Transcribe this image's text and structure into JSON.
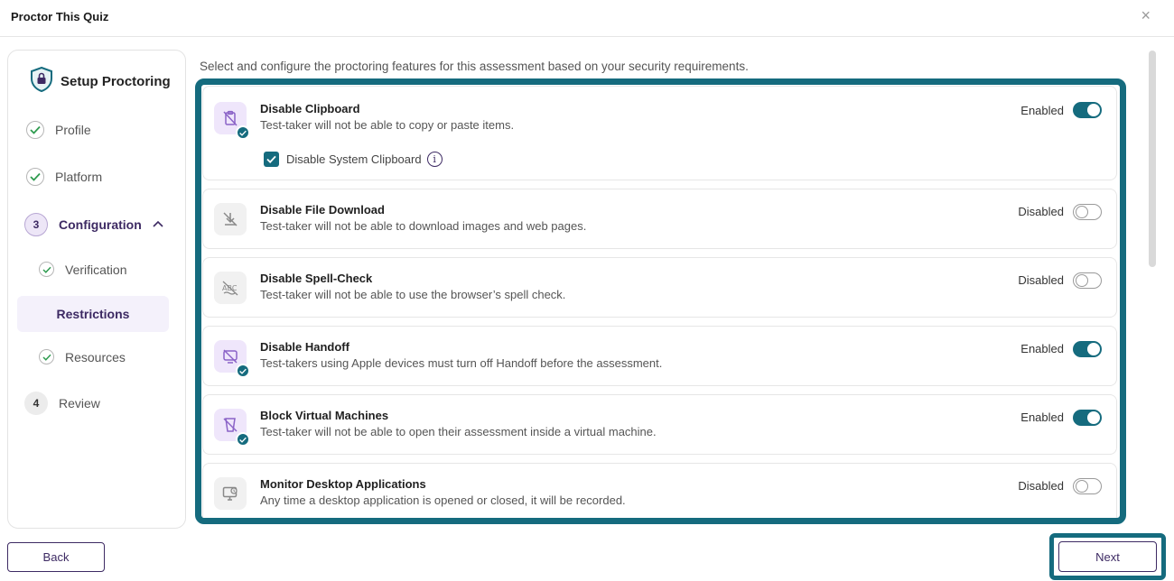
{
  "header": {
    "title": "Proctor This Quiz",
    "close_symbol": "×"
  },
  "sidebar": {
    "title": "Setup Proctoring",
    "steps": [
      {
        "label": "Profile",
        "state": "done"
      },
      {
        "label": "Platform",
        "state": "done"
      },
      {
        "label": "Configuration",
        "number": "3",
        "state": "active",
        "substeps": [
          {
            "label": "Verification",
            "state": "done"
          },
          {
            "label": "Restrictions",
            "state": "current"
          },
          {
            "label": "Resources",
            "state": "done"
          }
        ]
      },
      {
        "label": "Review",
        "number": "4",
        "state": "pending"
      }
    ]
  },
  "main": {
    "intro": "Select and configure the proctoring features for this assessment based on your security requirements.",
    "features": [
      {
        "title": "Disable Clipboard",
        "desc": "Test-taker will not be able to copy or paste items.",
        "status": "Enabled",
        "enabled": true,
        "icon": "clipboard-off-icon",
        "sub_option": {
          "label": "Disable System Clipboard",
          "checked": true
        }
      },
      {
        "title": "Disable File Download",
        "desc": "Test-taker will not be able to download images and web pages.",
        "status": "Disabled",
        "enabled": false,
        "icon": "download-off-icon"
      },
      {
        "title": "Disable Spell-Check",
        "desc": "Test-taker will not be able to use the browser’s spell check.",
        "status": "Disabled",
        "enabled": false,
        "icon": "spellcheck-off-icon"
      },
      {
        "title": "Disable Handoff",
        "desc": "Test-takers using Apple devices must turn off Handoff before the assessment.",
        "status": "Enabled",
        "enabled": true,
        "icon": "handoff-off-icon"
      },
      {
        "title": "Block Virtual Machines",
        "desc": "Test-taker will not be able to open their assessment inside a virtual machine.",
        "status": "Enabled",
        "enabled": true,
        "icon": "vm-block-icon"
      },
      {
        "title": "Monitor Desktop Applications",
        "desc": "Any time a desktop application is opened or closed, it will be recorded.",
        "status": "Disabled",
        "enabled": false,
        "icon": "desktop-monitor-icon"
      }
    ]
  },
  "footer": {
    "back_label": "Back",
    "next_label": "Next"
  },
  "colors": {
    "accent": "#156b7e",
    "brand": "#3d2a63",
    "icon_bg_on": "#efe6fb"
  }
}
